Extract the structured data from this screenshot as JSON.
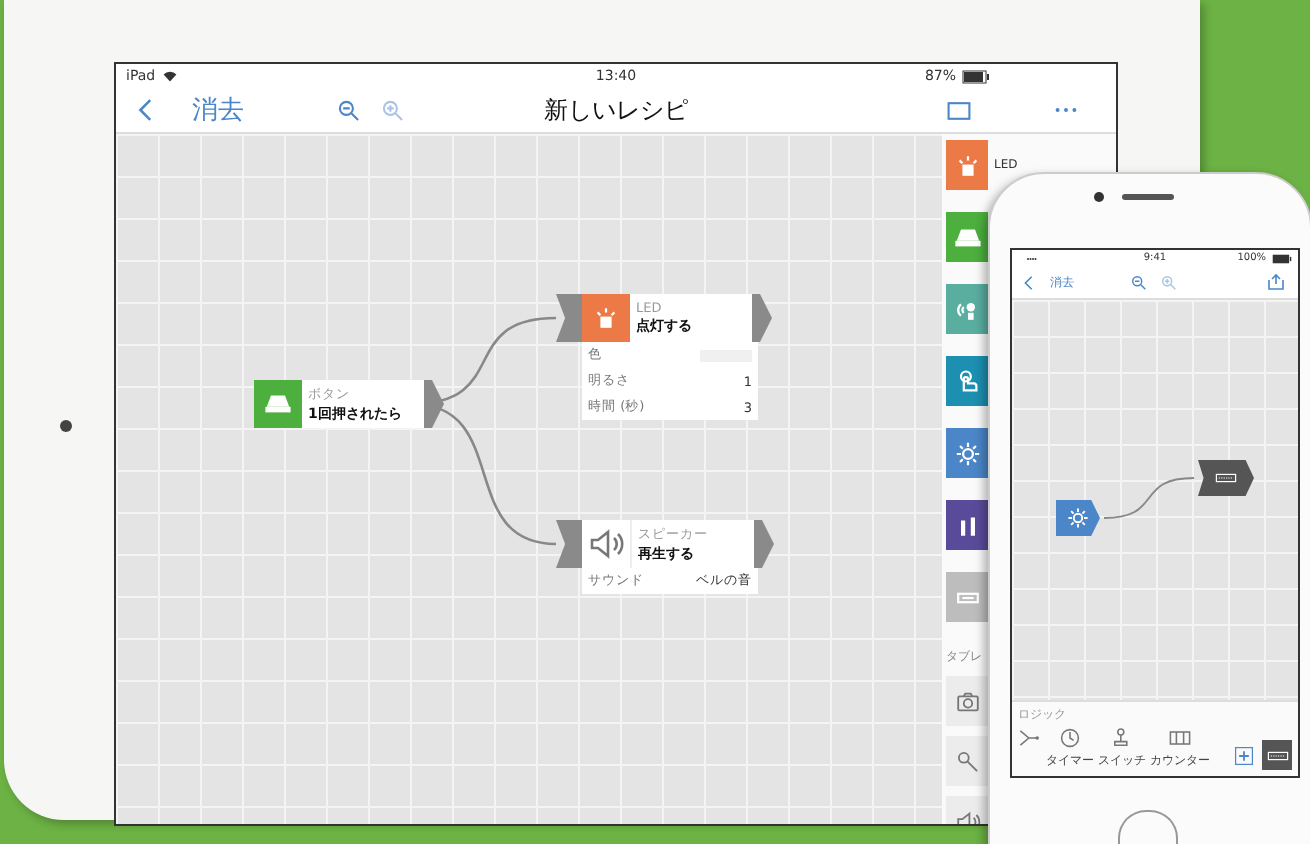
{
  "ipad": {
    "status": {
      "device": "iPad",
      "time": "13:40",
      "battery": "87%"
    },
    "nav": {
      "clear": "消去",
      "title": "新しいレシピ"
    },
    "nodes": [
      {
        "kind": "trigger",
        "color": "#4caf3e",
        "category": "ボタン",
        "action": "1回押されたら"
      },
      {
        "kind": "output",
        "color": "#ec7a47",
        "category": "LED",
        "action": "点灯する",
        "params": [
          {
            "label": "色"
          },
          {
            "label": "明るさ",
            "value": "1"
          },
          {
            "label": "時間 (秒)",
            "value": "3"
          }
        ]
      },
      {
        "kind": "output",
        "color": "#ffffff",
        "category": "スピーカー",
        "action": "再生する",
        "params": [
          {
            "label": "サウンド",
            "value": "ベルの音"
          }
        ]
      }
    ],
    "palette": [
      {
        "color": "#ec7a47",
        "label": "LED"
      },
      {
        "color": "#4caf3e"
      },
      {
        "color": "#5aaea0"
      },
      {
        "color": "#1d8fb0"
      },
      {
        "color": "#4a86c8"
      },
      {
        "color": "#5a4b9a"
      },
      {
        "color": "#bdbdbd"
      }
    ],
    "tablet_section": "タブレ"
  },
  "iphone": {
    "status": {
      "time": "9:41",
      "battery": "100%"
    },
    "nav": {
      "clear": "消去"
    },
    "nodes": [
      {
        "kind": "trigger",
        "color": "#4a86c8"
      },
      {
        "kind": "output",
        "color": "#555555"
      }
    ],
    "toolbar": {
      "section": "ロジック",
      "labels": [
        "タイマー",
        "スイッチ",
        "カウンター"
      ]
    }
  }
}
